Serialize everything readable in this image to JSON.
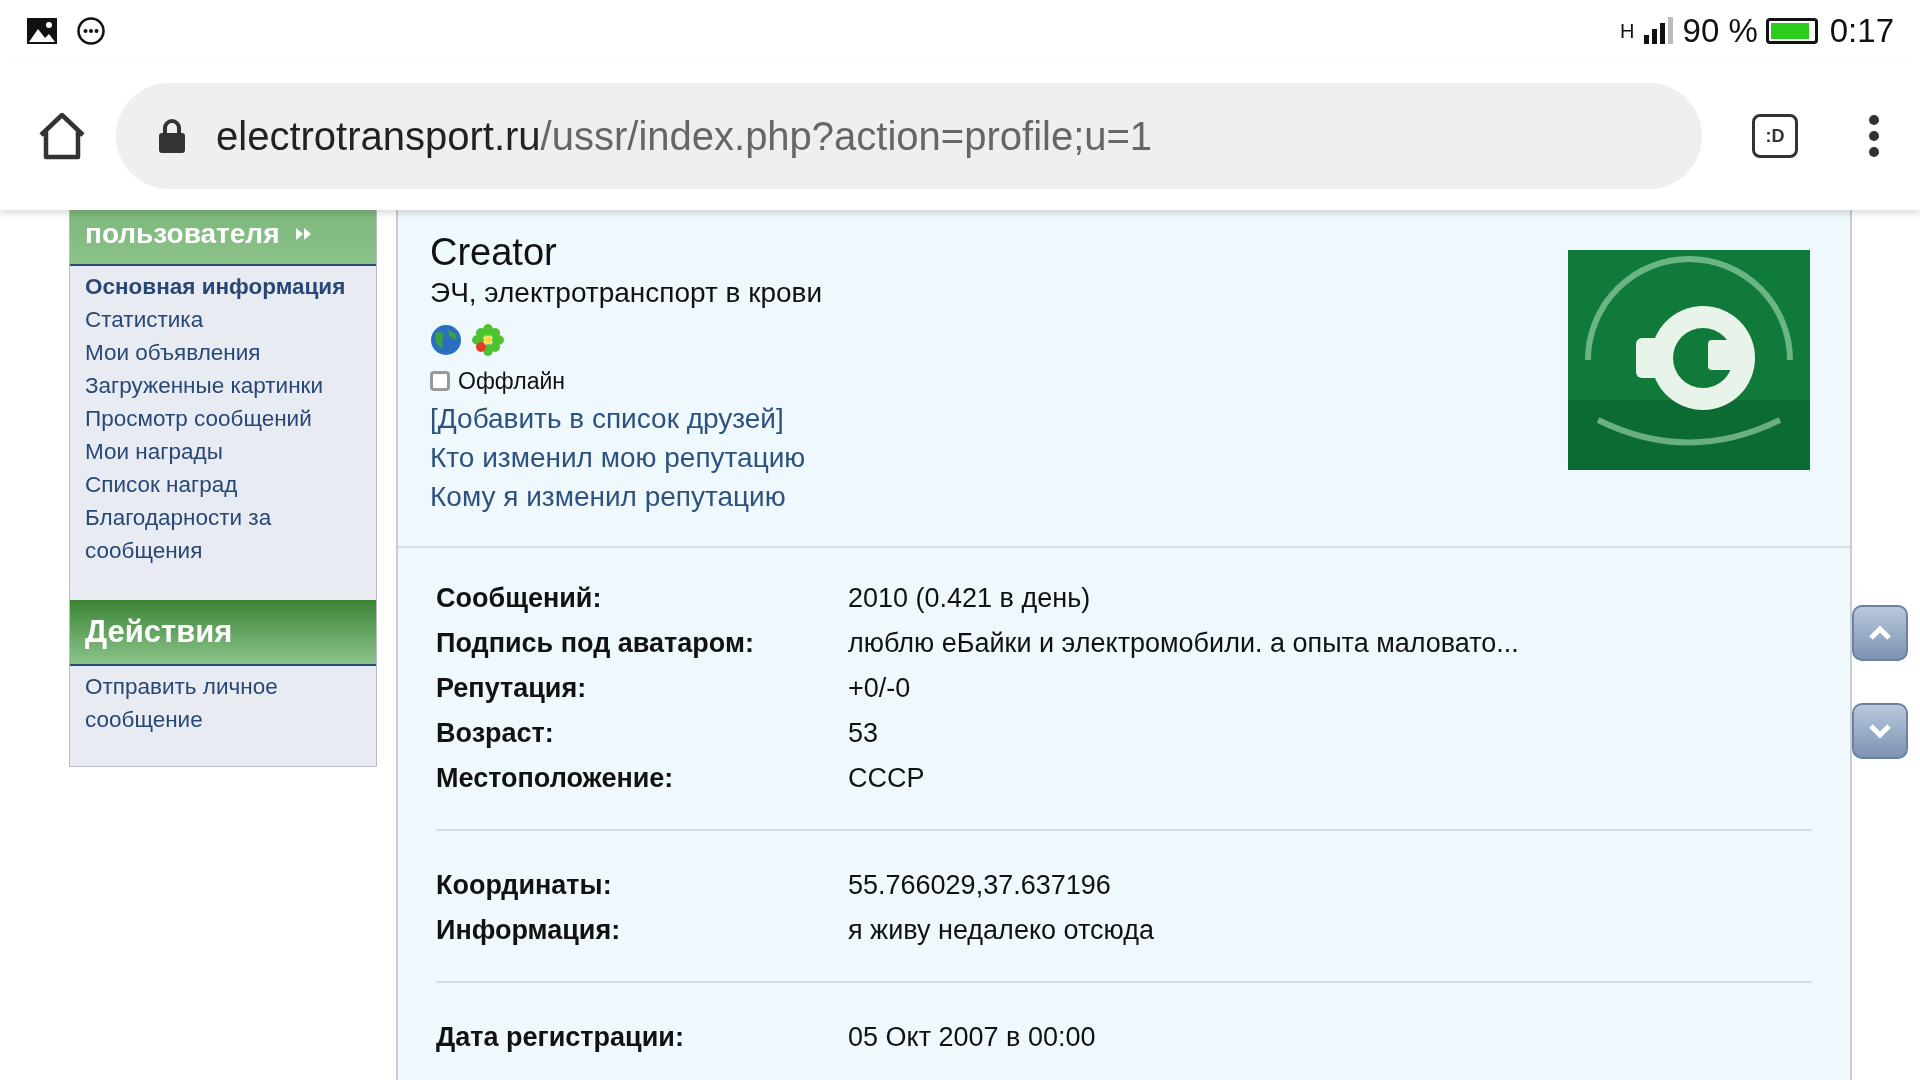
{
  "status_bar": {
    "network": "H",
    "battery_text": "90 %",
    "time": "0:17"
  },
  "browser": {
    "url_host": "electrotransport.ru",
    "url_path": "/ussr/index.php?action=profile;u=1",
    "tab_switcher": ":D"
  },
  "sidebar": {
    "sections": [
      {
        "title": "пользователя",
        "items": [
          {
            "label": "Основная информация",
            "selected": true
          },
          {
            "label": "Статистика",
            "selected": false
          },
          {
            "label": "Мои объявления",
            "selected": false
          },
          {
            "label": "Загруженные картинки",
            "selected": false
          },
          {
            "label": "Просмотр сообщений",
            "selected": false
          },
          {
            "label": "Мои награды",
            "selected": false
          },
          {
            "label": "Список наград",
            "selected": false
          },
          {
            "label": "Благодарности за сообщения",
            "selected": false
          }
        ]
      },
      {
        "title": "Действия",
        "items": [
          {
            "label": "Отправить личное сообщение",
            "selected": false
          }
        ]
      }
    ]
  },
  "profile": {
    "name": "Creator",
    "title": "ЭЧ, электротранспорт в крови",
    "online": false,
    "status": "Оффлайн",
    "links": [
      "[Добавить в список друзей]",
      "Кто изменил мою репутацию",
      "Кому я изменил репутацию"
    ],
    "avatar": {
      "kind": "picture"
    },
    "groups": [
      [
        {
          "label": "Сообщений:",
          "value": "2010 (0.421 в день)"
        },
        {
          "label": "Подпись под аватаром:",
          "value": "люблю еБайки и электромобили. а опыта маловато..."
        },
        {
          "label": "Репутация:",
          "value": "+0/-0"
        },
        {
          "label": "Возраст:",
          "value": "53"
        },
        {
          "label": "Местоположение:",
          "value": "СССР"
        }
      ],
      [
        {
          "label": "Координаты:",
          "value": "55.766029,37.637196"
        },
        {
          "label": "Информация:",
          "value": "я живу недалеко отсюда"
        }
      ],
      [
        {
          "label": "Дата регистрации:",
          "value": "05 Окт 2007 в 00:00"
        }
      ]
    ]
  }
}
